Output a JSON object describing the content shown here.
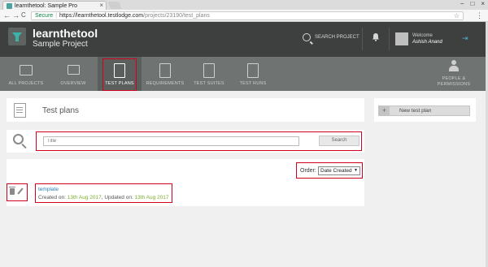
{
  "browser": {
    "tab_title": "learnthetool: Sample Pro",
    "tab_close": "×",
    "window_controls": [
      "−",
      "□",
      "×"
    ],
    "secure_label": "Secure",
    "url_host": "https://learnthetool.testlodge.com",
    "url_path": "/projects/23190/test_plans",
    "nav": {
      "back": "←",
      "forward": "→",
      "reload": "C"
    },
    "star_icon": "☆",
    "menu_icon": "⋮"
  },
  "header": {
    "app_title": "learnthetool",
    "project_name": "Sample Project",
    "search_label": "SEARCH PROJECT",
    "welcome_label": "Welcome",
    "username": "Ashish Anand",
    "logout_icon": "⇥",
    "colors": {
      "header_bg": "#3d403f",
      "nav_bg": "#6f7371",
      "link": "#2a7fb8",
      "date": "#7cae2c",
      "annotation": "#d0021b"
    }
  },
  "nav": {
    "items": [
      {
        "label": "ALL PROJECTS",
        "icon": "folder-icon"
      },
      {
        "label": "OVERVIEW",
        "icon": "overview-icon"
      },
      {
        "label": "TEST PLANS",
        "icon": "test-plans-icon",
        "active": true
      },
      {
        "label": "REQUIREMENTS",
        "icon": "document-icon"
      },
      {
        "label": "TEST SUITES",
        "icon": "list-icon"
      },
      {
        "label": "TEST RUNS",
        "icon": "checklist-icon"
      }
    ],
    "people_label_1": "PEOPLE &",
    "people_label_2": "PERMISSIONS"
  },
  "page": {
    "title": "Test plans",
    "new_button_label": "New test plan",
    "new_button_icon": "+"
  },
  "search": {
    "placeholder": "Title",
    "button_label": "Search"
  },
  "list": {
    "order_label": "Order:",
    "order_value": "Date Created",
    "order_caret": "▼",
    "plans": [
      {
        "name": "template",
        "created_label": "Created on:",
        "created_on": "13th Aug 2017",
        "updated_label": ", Updated on:",
        "updated_on": "13th Aug 2017"
      }
    ]
  }
}
